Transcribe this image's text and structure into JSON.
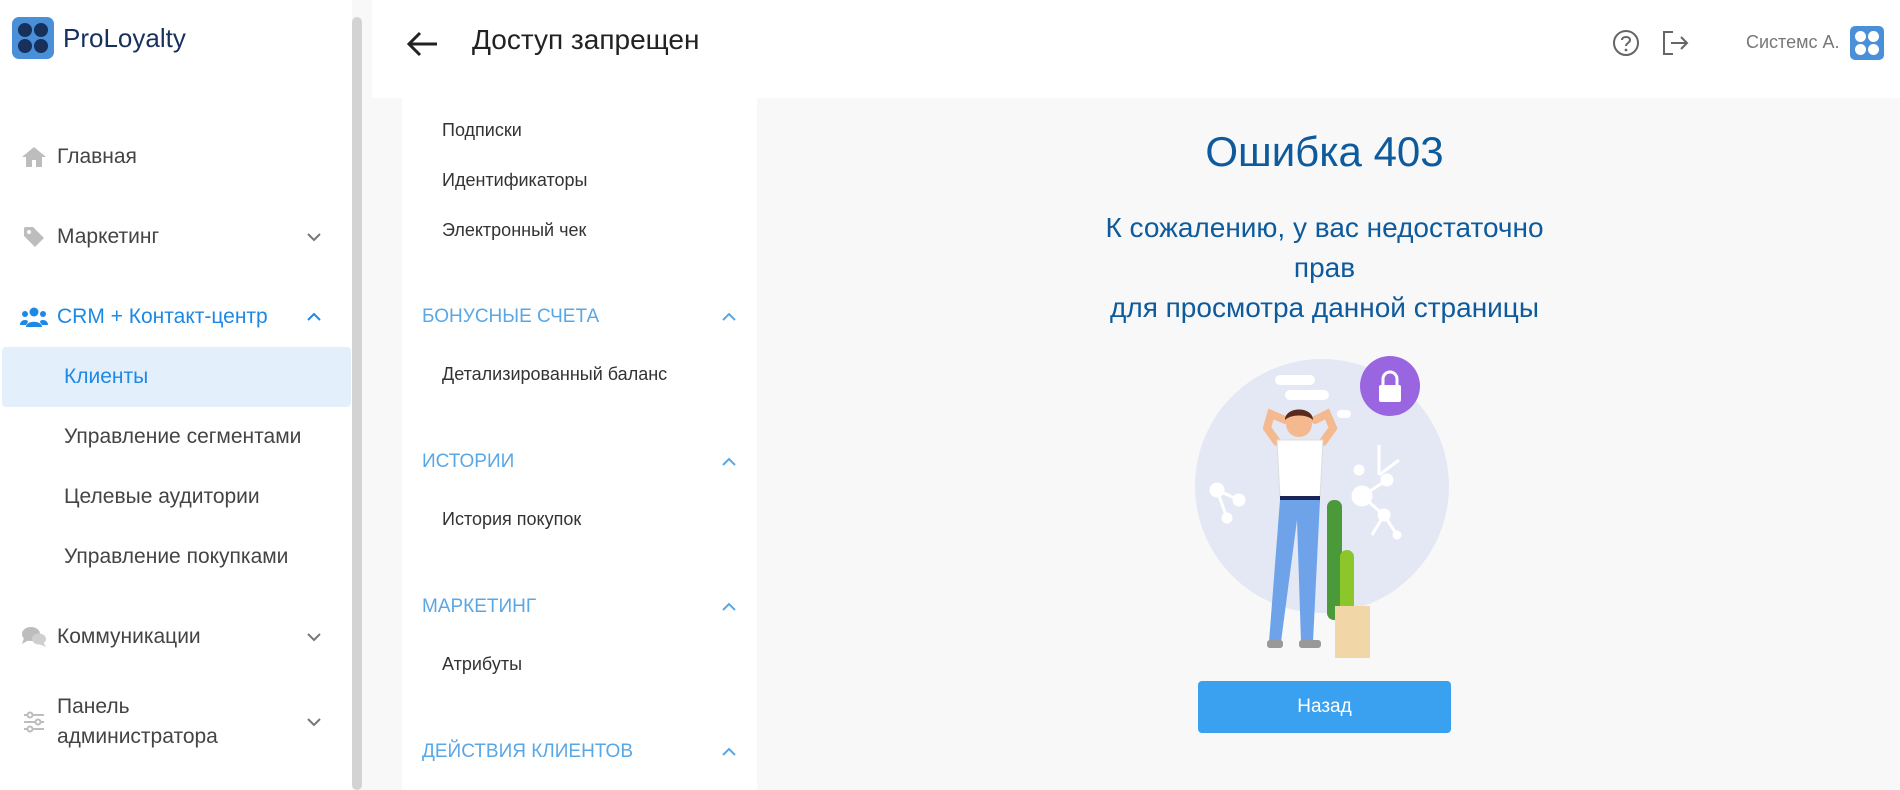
{
  "app": {
    "name": "ProLoyalty"
  },
  "sidebar": {
    "items": [
      {
        "label": "Главная",
        "icon": "home-icon"
      },
      {
        "label": "Маркетинг",
        "icon": "tag-icon"
      },
      {
        "label": "CRM + Контакт-центр",
        "icon": "users-icon"
      },
      {
        "label": "Коммуникации",
        "icon": "chat-icon"
      },
      {
        "label_line1": "Панель",
        "label_line2": "администратора",
        "icon": "sliders-icon"
      }
    ],
    "crm_subitems": [
      "Клиенты",
      "Управление сегментами",
      "Целевые аудитории",
      "Управление покупками"
    ],
    "active_color": "#1e88e5"
  },
  "header": {
    "title": "Доступ запрещен",
    "user_name": "Системс А."
  },
  "mid_nav": {
    "links_top": [
      "Подписки",
      "Идентификаторы",
      "Электронный чек"
    ],
    "sections": [
      {
        "title": "БОНУСНЫЕ СЧЕТА",
        "links": [
          "Детализированный баланс"
        ]
      },
      {
        "title": "ИСТОРИИ",
        "links": [
          "История покупок"
        ]
      },
      {
        "title": "МАРКЕТИНГ",
        "links": [
          "Атрибуты"
        ]
      },
      {
        "title": "ДЕЙСТВИЯ КЛИЕНТОВ",
        "links": []
      }
    ]
  },
  "error": {
    "title": "Ошибка 403",
    "message_line1": "К сожалению, у вас недостаточно",
    "message_line2": "прав",
    "message_line3": "для просмотра данной страницы",
    "button_label": "Назад"
  }
}
